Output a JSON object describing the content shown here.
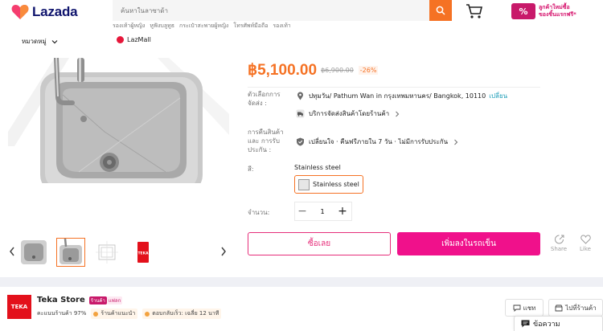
{
  "header": {
    "logo_text": "Lazada",
    "search_placeholder": "ค้นหาในลาซาด้า",
    "promo_badge": "%",
    "promo_line1": "ลูกค้าใหม่ซื้อ",
    "promo_line2": "ของชิ้นแรกฟรี*",
    "quick_links": [
      "รองเท้าผู้หญิง",
      "หูฟังบลูทูธ",
      "กระเป๋าสะพายผู้หญิง",
      "โทรศัพท์มือถือ",
      "รองเท้า"
    ],
    "category_label": "หมวดหมู่",
    "lazmall_label": "LazMall"
  },
  "product": {
    "price": "฿5,100.00",
    "old_price": "฿6,900.00",
    "discount": "-26%",
    "delivery_label": "ตัวเลือกการจัดส่ง :",
    "location": "ปทุมวัน/ Pathum Wan in กรุงเทพมหานคร/ Bangkok, 10110",
    "change_label": "เปลี่ยน",
    "shipping_text": "บริการจัดส่งสินค้าโดยร้านค้า",
    "return_label": "การคืนสินค้าและ การรับประกัน :",
    "return_text": "เปลี่ยนใจ · คืนฟรีภายใน 7 วัน · ไม่มีการรับประกัน",
    "color_label": "สี:",
    "color_value": "Stainless steel",
    "color_option": "Stainless steel",
    "qty_label": "จำนวน:",
    "qty_minus": "−",
    "qty_plus": "+",
    "qty_value": "1",
    "buy_now": "ซื้อเลย",
    "add_to_cart": "เพิ่มลงในรถเข็น",
    "share": "Share",
    "like": "Like",
    "thumb_logo": "TEKA"
  },
  "store": {
    "logo_text": "TEKA",
    "name": "Teka Store",
    "badge_official": "ร้านค้า",
    "badge_mall": "แฟลก",
    "rating": "คะแนนร้านค้า 97%",
    "recommended": "ร้านค้าแนะนำ",
    "response": "ตอบกลับเร็ว: เฉลี่ย 12 นาที",
    "chat_button": "แชท",
    "visit_button": "ไปที่ร้านค้า"
  },
  "chat_widget": {
    "label": "ข้อความ"
  },
  "colors": {
    "accent": "#f57224",
    "pink": "#f0118b",
    "brand_dark": "#0f146d"
  }
}
